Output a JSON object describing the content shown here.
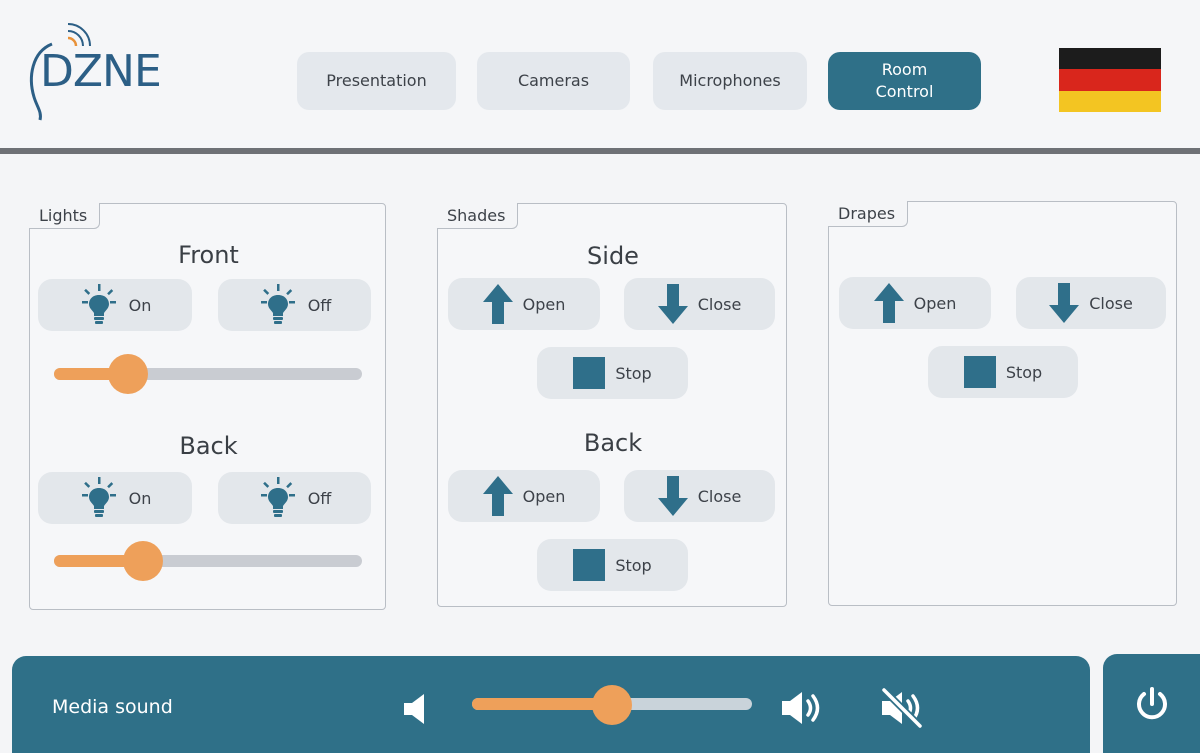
{
  "header": {
    "logo_text": "DZNE",
    "nav": [
      {
        "label": "Presentation"
      },
      {
        "label": "Cameras"
      },
      {
        "label": "Microphones"
      },
      {
        "label": "Room\nControl",
        "active": true
      }
    ],
    "flag_colors": [
      "#1c1c1c",
      "#d9261c",
      "#f3c522"
    ]
  },
  "lights": {
    "tab": "Lights",
    "front": {
      "title": "Front",
      "on_label": "On",
      "off_label": "Off",
      "level": 0.24
    },
    "back": {
      "title": "Back",
      "on_label": "On",
      "off_label": "Off",
      "level": 0.29
    }
  },
  "shades": {
    "tab": "Shades",
    "side": {
      "title": "Side",
      "open_label": "Open",
      "close_label": "Close",
      "stop_label": "Stop"
    },
    "back": {
      "title": "Back",
      "open_label": "Open",
      "close_label": "Close",
      "stop_label": "Stop"
    }
  },
  "drapes": {
    "tab": "Drapes",
    "open_label": "Open",
    "close_label": "Close",
    "stop_label": "Stop"
  },
  "media": {
    "label": "Media sound",
    "volume": 0.5
  },
  "colors": {
    "accent": "#2f7088",
    "slider": "#eea05a",
    "icon": "#2f6f8a"
  },
  "icons": {
    "light_on": "lightbulb-icon",
    "arrow_up": "arrow-up-icon",
    "arrow_down": "arrow-down-icon",
    "stop": "stop-square-icon",
    "vol_down": "volume-down-icon",
    "vol_up": "volume-up-icon",
    "mute": "mute-icon",
    "power": "power-icon"
  }
}
